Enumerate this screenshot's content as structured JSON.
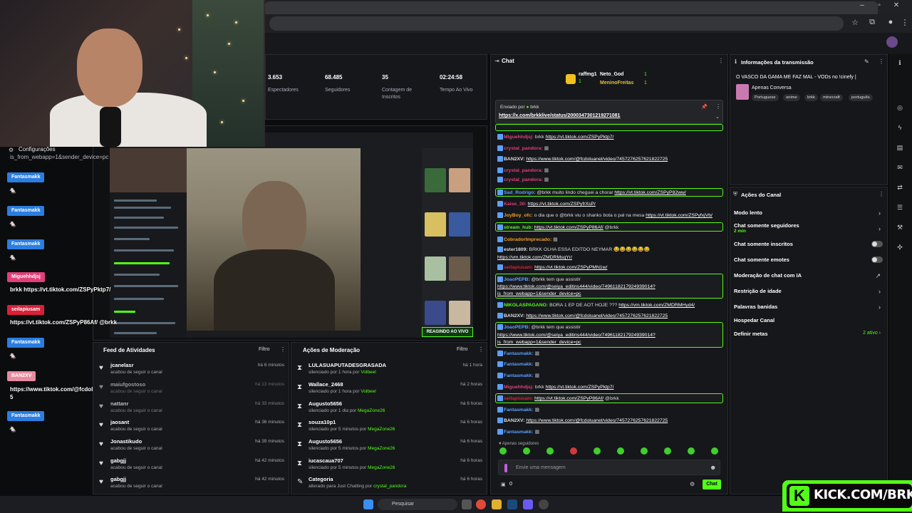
{
  "browser": {
    "address": "",
    "win_min": "–",
    "win_max": "▫",
    "win_close": "✕"
  },
  "stats": [
    {
      "value": "3.653",
      "label": "Espectadores"
    },
    {
      "value": "68.485",
      "label": "Seguidores"
    },
    {
      "value": "35",
      "label": "Contagem de Inscritos"
    },
    {
      "value": "02:24:58",
      "label": "Tempo Ao Vivo"
    }
  ],
  "overlay": {
    "config": "Configurações",
    "url_fragment": "is_from_webapp=1&sender_device=pc",
    "entries": [
      {
        "user": "Fantasmakk",
        "color": "#2b7de0",
        "msg": ""
      },
      {
        "user": "Fantasmakk",
        "color": "#2b7de0",
        "msg": ""
      },
      {
        "user": "Fantasmakk",
        "color": "#2b7de0",
        "msg": ""
      },
      {
        "user": "Miguehhdjsj",
        "color": "#e0407a",
        "msg": "brkk https://vt.tiktok.com/ZSPyPktp7/"
      },
      {
        "user": "seilapiusam",
        "color": "#d8203a",
        "msg": "https://vt.tiktok.com/ZSPyP86Af/ @brkk"
      },
      {
        "user": "Fantasmakk",
        "color": "#2b7de0",
        "msg": ""
      },
      {
        "user": "BAN2XV",
        "color": "#e88aa0",
        "msg": "https://www.tiktok.com/@fcdoluanel/video/745727625762182272 5"
      },
      {
        "user": "Fantasmakk",
        "color": "#2b7de0",
        "msg": ""
      }
    ]
  },
  "preview": {
    "reacting": "REAGINDO AO VIVO"
  },
  "feed": {
    "title": "Feed de Atividades",
    "filter": "Filtro",
    "dots": "⋮",
    "rows": [
      {
        "name": "jcanelasr",
        "sub": "acabou de seguir o canal",
        "time": "há 6 minutos"
      },
      {
        "name": "maiufgostoso",
        "sub": "acabou de seguir o canal",
        "time": "há 13 minutos"
      },
      {
        "name": "nattanr",
        "sub": "acabou de seguir o canal",
        "time": "há 33 minutos"
      },
      {
        "name": "jaosant",
        "sub": "acabou de seguir o canal",
        "time": "há 36 minutos"
      },
      {
        "name": "Jonastikudo",
        "sub": "acabou de seguir o canal",
        "time": "há 39 minutos"
      },
      {
        "name": "gabgjj",
        "sub": "acabou de seguir o canal",
        "time": "há 42 minutos"
      },
      {
        "name": "gabgjj",
        "sub": "acabou de seguir o canal",
        "time": "há 42 minutos"
      }
    ]
  },
  "mod": {
    "title": "Ações de Moderação",
    "filter": "Filtro",
    "dots": "⋮",
    "rows": [
      {
        "name": "LULASUAPUTADESGRASADA",
        "sub": "silenciado por 1 hora por ",
        "by": "Volbeel",
        "time": "há 1 hora"
      },
      {
        "name": "Wallace_2468",
        "sub": "silenciado por 1 hora por ",
        "by": "Volbeel",
        "time": "há 2 horas"
      },
      {
        "name": "Augusto5656",
        "sub": "silenciado por 1 dia por ",
        "by": "MegaZone26",
        "time": "há 6 horas"
      },
      {
        "name": "souza10p1",
        "sub": "silenciado por 5 minutos por ",
        "by": "MegaZone26",
        "time": "há 6 horas"
      },
      {
        "name": "Augusto5656",
        "sub": "silenciado por 5 minutos por ",
        "by": "MegaZone26",
        "time": "há 6 horas"
      },
      {
        "name": "iucascaua707",
        "sub": "silenciado por 5 minutos por ",
        "by": "MegaZone26",
        "time": "há 6 horas"
      },
      {
        "name": "Categoria",
        "sub": "alterado para Just Chatting por ",
        "by": "crystal_pandora",
        "time": "há 6 horas"
      }
    ]
  },
  "chat": {
    "title": "Chat",
    "dots": "⋮",
    "leaderboard": [
      {
        "name": "raffmg1",
        "count": "1"
      },
      {
        "name": "Neto_God",
        "count": "1"
      },
      {
        "name": "MeninoFreitas",
        "count": "1"
      }
    ],
    "pinned_by": "Enviado por",
    "pinned_user": "brkk",
    "pinned_link": "https://x.com/brkklive/status/2000347301219271081",
    "messages": [
      {
        "user": "Miguehhdjsj:",
        "ucolor": "#e0407a",
        "text": "brkk ",
        "link": "https://vt.tiktok.com/ZSPyPktp7/",
        "hl": false
      },
      {
        "user": "crystal_pandora:",
        "ucolor": "#e0407a",
        "text": "",
        "link": "",
        "hl": false
      },
      {
        "user": "BAN2XV:",
        "ucolor": "#ddd",
        "text": "",
        "link": "https://www.tiktok.com/@fcdoluanel/video/7457276257621822725",
        "hl": false
      },
      {
        "user": "crystal_pandora:",
        "ucolor": "#e0407a",
        "text": "",
        "link": "",
        "hl": false
      },
      {
        "user": "crystal_pandora:",
        "ucolor": "#e0407a",
        "text": "",
        "link": "",
        "hl": false
      },
      {
        "user": "Sad_Rodrigo:",
        "ucolor": "#5aa0ff",
        "text": "@brkk muito lindo cheguei a chorar ",
        "link": "https://vt.tiktok.com/ZSPyP82ww/",
        "hl": true
      },
      {
        "user": "Kaise_30:",
        "ucolor": "#e0407a",
        "text": "",
        "link": "https://vt.tiktok.com/ZSPyfrXsP/",
        "hl": false
      },
      {
        "user": "JoyBoy_ofc:",
        "ucolor": "#f0a020",
        "text": "o dia que o @brkk viu o shanks bota o pal na mesa ",
        "link": "https://vt.tiktok.com/ZSPyfxjVb/",
        "hl": false
      },
      {
        "user": "stream_hub:",
        "ucolor": "#53fc18",
        "text": "",
        "link": "https://vt.tiktok.com/ZSPyP86Af/",
        "tail": " @brkk",
        "hl": true
      },
      {
        "user": "CobradorImprecado:",
        "ucolor": "#f0a020",
        "text": "",
        "link": "",
        "hl": false
      },
      {
        "user": "ester1809:",
        "ucolor": "#ddd",
        "text": "BRKK OLHA ESSA EDITDO NEYMAR 😂😂😂😂😂😂",
        "link": "",
        "hl": false
      },
      {
        "user": "",
        "ucolor": "#ddd",
        "text": "",
        "link": "https://vm.tiktok.com/ZMDRMsqYr/",
        "hl": false
      },
      {
        "user": "seilapiusam:",
        "ucolor": "#d8203a",
        "text": "",
        "link": "https://vt.tiktok.com/ZSPyPMN1w/",
        "hl": false
      },
      {
        "user": "JoaoPEPB:",
        "ucolor": "#5aa0ff",
        "text": "@brkk tem que assistir",
        "link": "",
        "hl": true
      },
      {
        "user": "",
        "ucolor": "#ddd",
        "text": "",
        "link": "https://www.tiktok.com/@seiya_editins444/video/7496118217924939014?",
        "hl": false
      },
      {
        "user": "",
        "ucolor": "#ddd",
        "text": "",
        "link": "is_from_webapp=1&sender_device=pc",
        "hl": false
      },
      {
        "user": "NIKOLASPAGANO:",
        "ucolor": "#53fc18",
        "text": "BORA 1 EP DE AOT HOJE ??? ",
        "link": "https://vm.tiktok.com/ZMDRMHyd4/",
        "hl": false
      },
      {
        "user": "BAN2XV:",
        "ucolor": "#ddd",
        "text": "",
        "link": "https://www.tiktok.com/@fcdoluanel/video/7457276257621822725",
        "hl": false
      },
      {
        "user": "JoaoPEPB:",
        "ucolor": "#5aa0ff",
        "text": "@brkk tem que assistir",
        "link": "",
        "hl": true
      },
      {
        "user": "",
        "ucolor": "#ddd",
        "text": "",
        "link": "https://www.tiktok.com/@seiya_editins444/video/7496118217924939014?",
        "hl": false
      },
      {
        "user": "",
        "ucolor": "#ddd",
        "text": "",
        "link": "is_from_webapp=1&sender_device=pc",
        "hl": false
      },
      {
        "user": "Fantasmakk:",
        "ucolor": "#5aa0ff",
        "text": "",
        "link": "",
        "hl": false
      },
      {
        "user": "Fantasmakk:",
        "ucolor": "#5aa0ff",
        "text": "",
        "link": "",
        "hl": false
      },
      {
        "user": "Fantasmakk:",
        "ucolor": "#5aa0ff",
        "text": "",
        "link": "",
        "hl": false
      },
      {
        "user": "Miguehhdjsj:",
        "ucolor": "#e0407a",
        "text": "brkk ",
        "link": "https://vt.tiktok.com/ZSPyPktp7/",
        "hl": false
      },
      {
        "user": "seilapiusam:",
        "ucolor": "#d8203a",
        "text": "",
        "link": "https://vt.tiktok.com/ZSPyP86Af/",
        "tail": " @brkk",
        "hl": true
      },
      {
        "user": "Fantasmakk:",
        "ucolor": "#5aa0ff",
        "text": "",
        "link": "",
        "hl": false
      },
      {
        "user": "BAN2XV:",
        "ucolor": "#ddd",
        "text": "",
        "link": "https://www.tiktok.com/@fcdoluanel/video/7457276257621822725",
        "hl": false
      },
      {
        "user": "Fantasmakk:",
        "ucolor": "#5aa0ff",
        "text": "",
        "link": "",
        "hl": false
      }
    ],
    "followers_only": "Apenas seguidores",
    "input_placeholder": "Envie uma mensagem",
    "count": "0",
    "send": "Chat"
  },
  "info": {
    "title": "Informações da transmissão",
    "stream_title": "O VASCO DA GAMA ME FAZ MAL - VODs no !cinefy |",
    "category": "Apenas Conversa",
    "tags": [
      "Portuguese",
      "anime",
      "brkk",
      "minecraft",
      "português"
    ]
  },
  "actions": {
    "title": "Ações do Canal",
    "items": [
      {
        "label": "Modo lento",
        "sub": "",
        "right": "›"
      },
      {
        "label": "Chat somente seguidores",
        "sub": "2 min",
        "right": "›"
      },
      {
        "label": "Chat somente inscritos",
        "sub": "",
        "right": "toggle"
      },
      {
        "label": "Chat somente emotes",
        "sub": "",
        "right": "toggle"
      },
      {
        "label": "Moderação de chat com IA",
        "sub": "",
        "right": "↗"
      },
      {
        "label": "Restrição de idade",
        "sub": "",
        "right": "›"
      },
      {
        "label": "Palavras banidas",
        "sub": "",
        "right": "›"
      },
      {
        "label": "Hospedar Canal",
        "sub": "",
        "right": ""
      },
      {
        "label": "Definir metas",
        "sub": "",
        "right": "2 ativo ›"
      }
    ]
  },
  "taskbar": {
    "search": "Pesquisar"
  },
  "banner": {
    "text": "KICK.COM/BRKK",
    "k": "K"
  }
}
